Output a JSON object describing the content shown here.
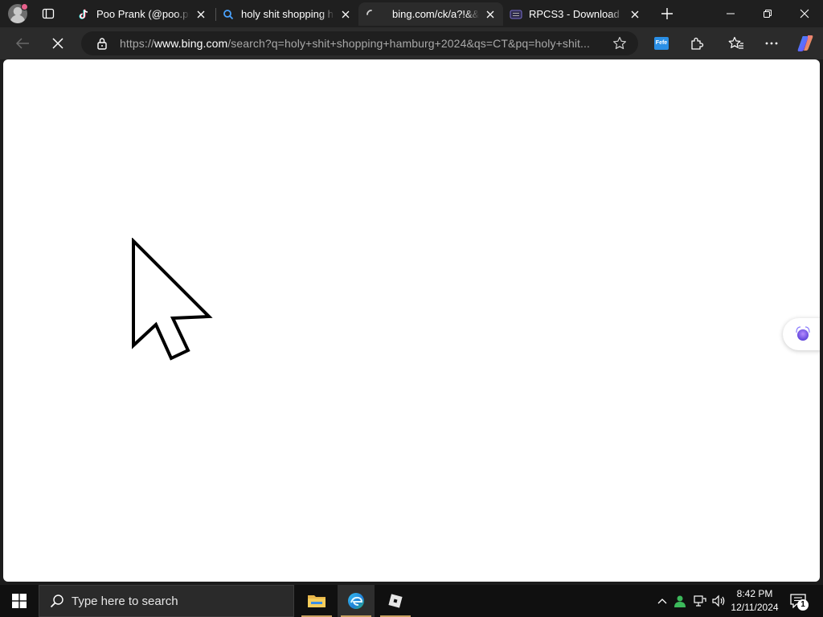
{
  "browser": {
    "tabs": [
      {
        "title": "Poo Prank (@poo.pran",
        "favicon": "tiktok-icon",
        "active": false
      },
      {
        "title": "holy shit shopping han",
        "favicon": "search-icon",
        "active": false
      },
      {
        "title": "bing.com/ck/a?!&&p=",
        "favicon": "loading-icon",
        "active": true
      },
      {
        "title": "RPCS3 - Download",
        "favicon": "rpcs3-icon",
        "active": false
      }
    ],
    "address": {
      "scheme": "https://",
      "host": "www.bing.com",
      "path": "/search?q=holy+shit+shopping+hamburg+2024&qs=CT&pq=holy+shit..."
    },
    "extension_badge": "Fefe"
  },
  "taskbar": {
    "search_placeholder": "Type here to search",
    "apps": [
      "file-explorer-icon",
      "edge-icon",
      "roblox-icon"
    ],
    "clock": {
      "time": "8:42 PM",
      "date": "12/11/2024"
    },
    "notification_count": "1"
  },
  "colors": {
    "accent": "#3b8eea",
    "taskbar": "#101010",
    "tabstrip": "#1f1f1f",
    "toolbar": "#2b2b2b"
  }
}
